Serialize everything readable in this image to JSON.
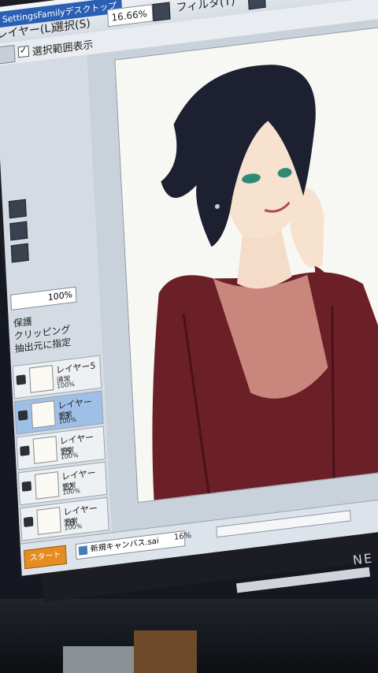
{
  "app": {
    "title": "SettingsFamilyデスクトップ"
  },
  "menu": {
    "layer": "レイヤー(L)",
    "select": "選択(S)",
    "filter": "フィルタ(T)"
  },
  "toolbar": {
    "zoom": "16.66%",
    "show_selection_label": "選択範囲表示"
  },
  "left_panel": {
    "opacity": "100%",
    "text_1": "保護",
    "text_2": "クリッピング",
    "text_3": "抽出元に指定"
  },
  "layers": [
    {
      "name": "レイヤー5",
      "mode": "通常",
      "opacity": "100%"
    },
    {
      "name": "レイヤー13",
      "mode": "通常",
      "opacity": "100%"
    },
    {
      "name": "レイヤー15",
      "mode": "通常",
      "opacity": "100%"
    },
    {
      "name": "レイヤー12",
      "mode": "通常",
      "opacity": "100%"
    },
    {
      "name": "レイヤー18",
      "mode": "通常",
      "opacity": "100%"
    }
  ],
  "status": {
    "doc_name": "新規キャンバス.sai",
    "doc_zoom": "16%",
    "start": "スタート"
  },
  "monitor": {
    "brand": "NE"
  },
  "colors": {
    "accent": "#2a5fb4",
    "selected_layer": "#9fc0e6",
    "jacket": "#6b1f26",
    "shirt": "#c9867d",
    "hair": "#1c2030"
  }
}
